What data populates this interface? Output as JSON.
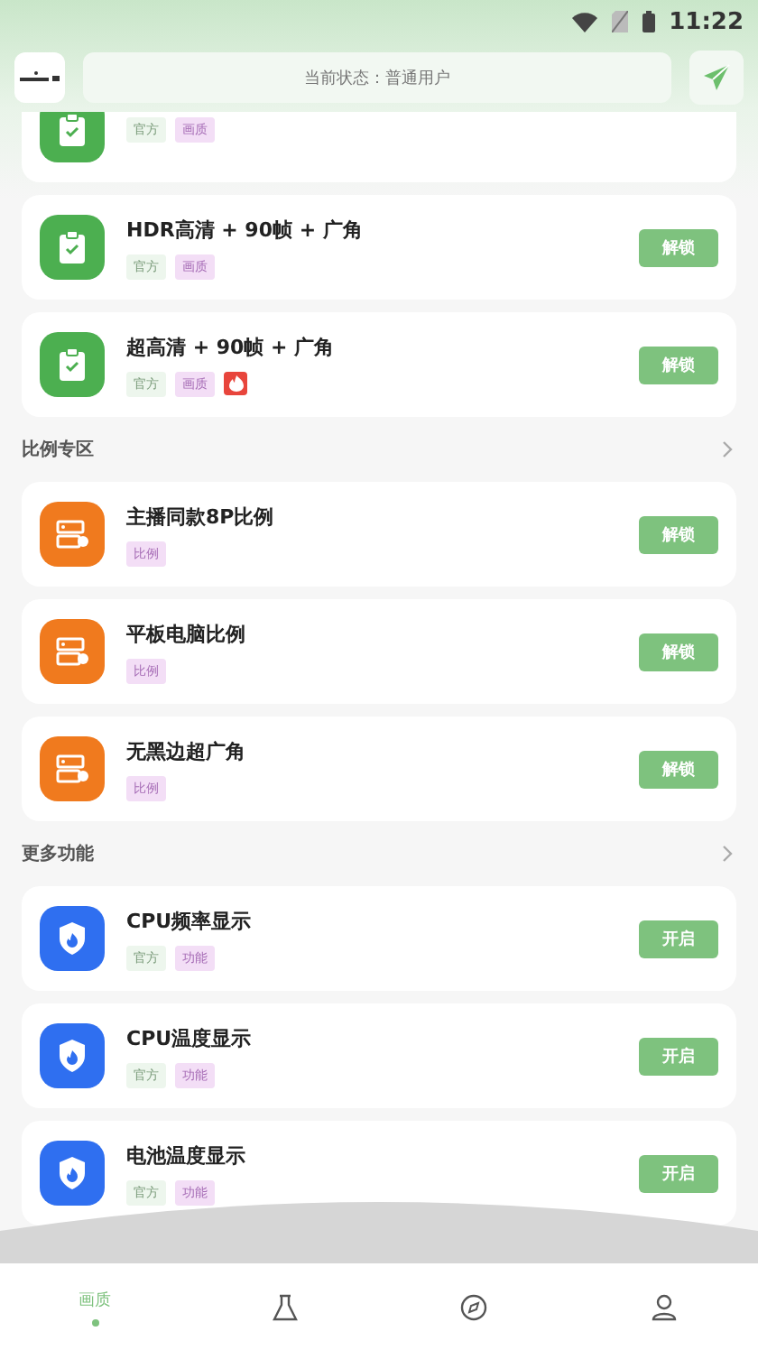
{
  "status_bar": {
    "time": "11:22"
  },
  "header": {
    "status_text": "当前状态：普通用户"
  },
  "sections": [
    {
      "items": [
        {
          "tags": [
            {
              "kind": "official",
              "label": "官方"
            },
            {
              "kind": "category",
              "label": "画质"
            }
          ]
        },
        {
          "title": "HDR高清 + 90帧 + 广角",
          "button": "解锁",
          "tags": [
            {
              "kind": "official",
              "label": "官方"
            },
            {
              "kind": "category",
              "label": "画质"
            }
          ]
        },
        {
          "title": "超高清 + 90帧 + 广角",
          "button": "解锁",
          "tags": [
            {
              "kind": "official",
              "label": "官方"
            },
            {
              "kind": "category",
              "label": "画质"
            },
            {
              "kind": "hot"
            }
          ]
        }
      ]
    },
    {
      "title": "比例专区",
      "items": [
        {
          "title": "主播同款8P比例",
          "button": "解锁",
          "tags": [
            {
              "kind": "category",
              "label": "比例"
            }
          ]
        },
        {
          "title": "平板电脑比例",
          "button": "解锁",
          "tags": [
            {
              "kind": "category",
              "label": "比例"
            }
          ]
        },
        {
          "title": "无黑边超广角",
          "button": "解锁",
          "tags": [
            {
              "kind": "category",
              "label": "比例"
            }
          ]
        }
      ]
    },
    {
      "title": "更多功能",
      "items": [
        {
          "title": "CPU频率显示",
          "button": "开启",
          "tags": [
            {
              "kind": "official",
              "label": "官方"
            },
            {
              "kind": "category",
              "label": "功能"
            }
          ]
        },
        {
          "title": "CPU温度显示",
          "button": "开启",
          "tags": [
            {
              "kind": "official",
              "label": "官方"
            },
            {
              "kind": "category",
              "label": "功能"
            }
          ]
        },
        {
          "title": "电池温度显示",
          "button": "开启",
          "tags": [
            {
              "kind": "official",
              "label": "官方"
            },
            {
              "kind": "category",
              "label": "功能"
            }
          ]
        }
      ]
    }
  ],
  "nav": [
    {
      "kind": "text",
      "label": "画质",
      "selected": true
    },
    {
      "kind": "flask",
      "selected": false
    },
    {
      "kind": "compass",
      "selected": false
    },
    {
      "kind": "user",
      "selected": false
    }
  ]
}
